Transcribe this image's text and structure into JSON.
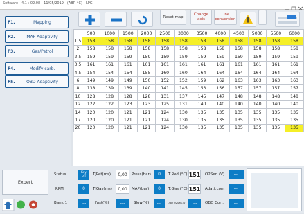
{
  "window": {
    "title": "Software - 4.1 : 02.08 - 11/05/2019 - (ABP 4C) - LPG"
  },
  "sidebar": {
    "items": [
      {
        "key": "F1.",
        "label": "Mapping"
      },
      {
        "key": "F2.",
        "label": "MAP Adaptivity"
      },
      {
        "key": "F3.",
        "label": "Gas/Petrol"
      },
      {
        "key": "F4.",
        "label": "Modify carb."
      },
      {
        "key": "F5.",
        "label": "OBD Adaptivity"
      }
    ]
  },
  "toolbar": {
    "reset_label": "Reset map",
    "change_label": "Change\naxis",
    "line_label": "Line\nconversion",
    "dashes": "---"
  },
  "colors": {
    "highlight": "#f5ef27",
    "accent": "#0d7dc6",
    "nav_border": "#1e5c96"
  },
  "map": {
    "columns": [
      "500",
      "1000",
      "1500",
      "2000",
      "2500",
      "3000",
      "3500",
      "4000",
      "4500",
      "5000",
      "5500",
      "6000"
    ],
    "rows": [
      {
        "label": "1,5",
        "values": [
          "158",
          "158",
          "158",
          "158",
          "158",
          "158",
          "158",
          "158",
          "158",
          "158",
          "158",
          "158"
        ],
        "hl": [
          1,
          1,
          1,
          1,
          1,
          1,
          1,
          1,
          1,
          1,
          1,
          1
        ]
      },
      {
        "label": "2",
        "values": [
          "158",
          "158",
          "158",
          "158",
          "158",
          "158",
          "158",
          "158",
          "158",
          "158",
          "158",
          "158"
        ],
        "hl": [
          0,
          0,
          0,
          0,
          0,
          0,
          0,
          0,
          0,
          0,
          0,
          0
        ]
      },
      {
        "label": "2,5",
        "values": [
          "159",
          "159",
          "159",
          "159",
          "159",
          "159",
          "159",
          "159",
          "159",
          "159",
          "159",
          "159"
        ],
        "hl": [
          0,
          0,
          0,
          0,
          0,
          0,
          0,
          0,
          0,
          0,
          0,
          0
        ]
      },
      {
        "label": "3,5",
        "values": [
          "161",
          "161",
          "161",
          "161",
          "161",
          "161",
          "161",
          "161",
          "161",
          "161",
          "161",
          "161"
        ],
        "hl": [
          0,
          0,
          0,
          0,
          0,
          0,
          0,
          0,
          0,
          0,
          0,
          0
        ]
      },
      {
        "label": "4,5",
        "values": [
          "154",
          "154",
          "154",
          "155",
          "160",
          "160",
          "164",
          "164",
          "164",
          "164",
          "164",
          "164"
        ],
        "hl": [
          0,
          0,
          0,
          0,
          0,
          0,
          0,
          0,
          0,
          0,
          0,
          0
        ]
      },
      {
        "label": "6",
        "values": [
          "149",
          "149",
          "149",
          "150",
          "152",
          "152",
          "159",
          "162",
          "163",
          "163",
          "163",
          "163"
        ],
        "hl": [
          0,
          0,
          0,
          0,
          0,
          0,
          0,
          0,
          0,
          0,
          0,
          0
        ]
      },
      {
        "label": "8",
        "values": [
          "138",
          "139",
          "139",
          "140",
          "141",
          "145",
          "153",
          "156",
          "157",
          "157",
          "157",
          "157"
        ],
        "hl": [
          0,
          0,
          0,
          0,
          0,
          0,
          0,
          0,
          0,
          0,
          0,
          0
        ]
      },
      {
        "label": "10",
        "values": [
          "128",
          "128",
          "128",
          "128",
          "131",
          "137",
          "145",
          "147",
          "148",
          "148",
          "148",
          "148"
        ],
        "hl": [
          0,
          0,
          0,
          0,
          0,
          0,
          0,
          0,
          0,
          0,
          0,
          0
        ]
      },
      {
        "label": "12",
        "values": [
          "122",
          "122",
          "123",
          "123",
          "125",
          "131",
          "140",
          "140",
          "140",
          "140",
          "140",
          "140"
        ],
        "hl": [
          0,
          0,
          0,
          0,
          0,
          0,
          0,
          0,
          0,
          0,
          0,
          0
        ]
      },
      {
        "label": "14",
        "values": [
          "120",
          "120",
          "121",
          "121",
          "124",
          "130",
          "135",
          "135",
          "135",
          "135",
          "135",
          "135"
        ],
        "hl": [
          0,
          0,
          0,
          0,
          0,
          0,
          0,
          0,
          0,
          0,
          0,
          0
        ]
      },
      {
        "label": "17",
        "values": [
          "120",
          "120",
          "121",
          "121",
          "124",
          "130",
          "135",
          "135",
          "135",
          "135",
          "135",
          "135"
        ],
        "hl": [
          0,
          0,
          0,
          0,
          0,
          0,
          0,
          0,
          0,
          0,
          0,
          0
        ]
      },
      {
        "label": "20",
        "values": [
          "120",
          "120",
          "121",
          "121",
          "124",
          "130",
          "135",
          "135",
          "135",
          "135",
          "135",
          "135"
        ],
        "hl": [
          0,
          0,
          0,
          0,
          0,
          0,
          0,
          0,
          0,
          0,
          0,
          1
        ]
      }
    ]
  },
  "status": {
    "expert_label": "Expert",
    "status_label": "Status",
    "key_value": "Key\noff",
    "rpm_label": "RPM",
    "rpm_value": "0",
    "bank1_label": "Bank 1",
    "bank1_value": "---",
    "tipet_label": "TjPet(ms)",
    "tipet_value": "0,00",
    "tigas_label": "TjGas(ms)",
    "tigas_value": "0,00",
    "fast_label": "Fast(%)",
    "fast_value": "---",
    "press_label": "Press(bar)",
    "press_value": "0",
    "map_label": "MAP(bar)",
    "map_value": "0",
    "slow_label": "Slow(%)",
    "slow_value": "---",
    "tred_label": "T.Red (°C)",
    "tred_value": "151",
    "tgas_label": "T.Gas (°C)",
    "tgas_value": "151",
    "o2_label": "OBD O2Sen.(V)",
    "o2_value": "---",
    "o2sen_label": "O2Sen.(V)",
    "o2sen_value": "---",
    "adatt_label": "Adatt.corr.",
    "adatt_value": "---",
    "obdcorr_label": "OBD Corr.",
    "obdcorr_value": "---"
  }
}
